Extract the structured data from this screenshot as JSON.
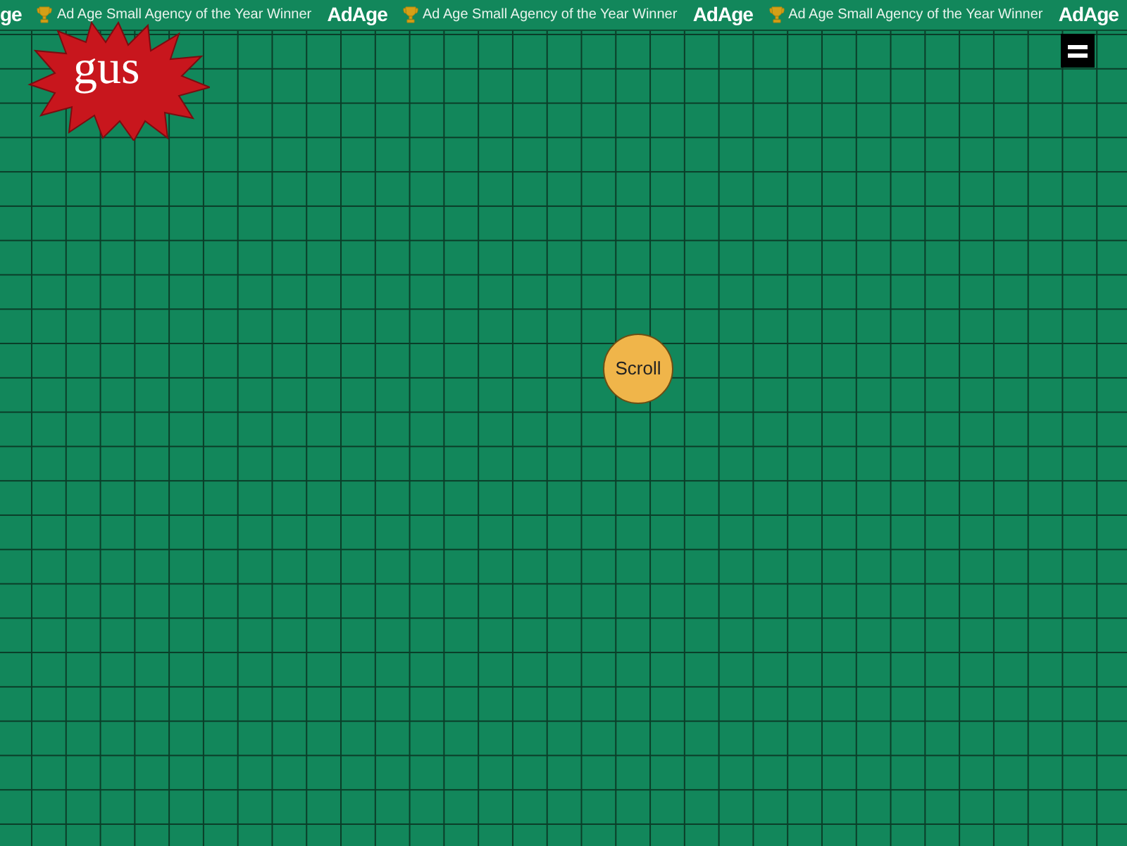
{
  "ticker": [
    {
      "kind": "logo",
      "text": "ge"
    },
    {
      "kind": "award",
      "text": "Ad Age Small Agency of the Year Winner"
    },
    {
      "kind": "logo",
      "text": "AdAge"
    },
    {
      "kind": "award",
      "text": "Ad Age Small Agency of the Year Winner"
    },
    {
      "kind": "logo",
      "text": "AdAge"
    },
    {
      "kind": "award",
      "text": "Ad Age Small Agency of the Year Winner"
    },
    {
      "kind": "logo",
      "text": "AdAge"
    }
  ],
  "logo": {
    "text": "gus"
  },
  "scroll_button": {
    "label": "Scroll"
  }
}
